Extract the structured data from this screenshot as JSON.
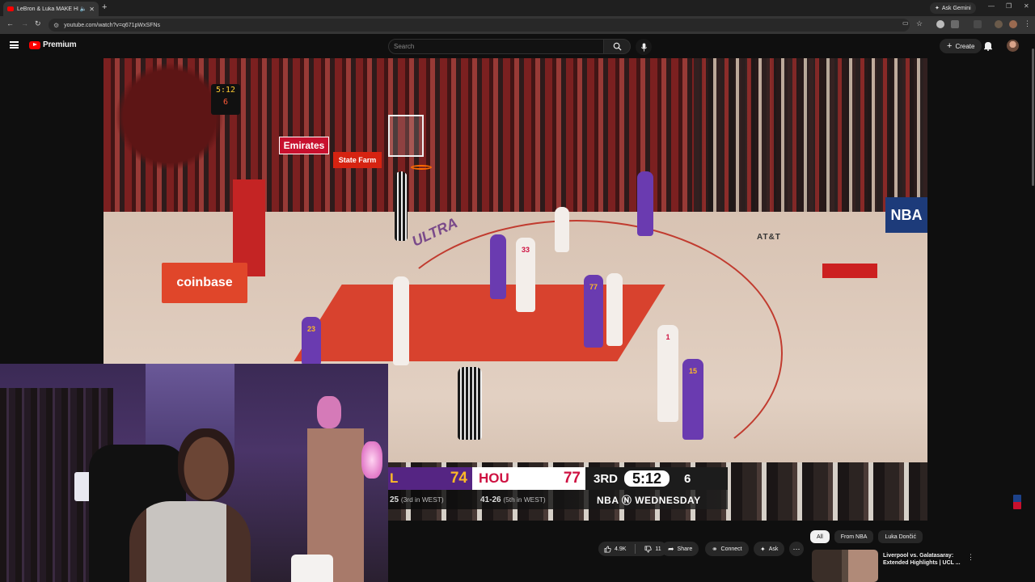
{
  "browser": {
    "tab_title": "LeBron & Luka MAKE HISTORY",
    "url": "youtube.com/watch?v=q671pWxSFNs",
    "ask_gemini": "Ask Gemini"
  },
  "header": {
    "logo_text": "Premium",
    "search_placeholder": "Search",
    "create_label": "Create"
  },
  "video": {
    "ads": {
      "emirates": "Emirates",
      "statefarm": "State Farm",
      "coinbase": "coinbase",
      "nba": "NBA",
      "att": "AT&T",
      "ultra": "ULTRA"
    },
    "shot_clock": {
      "game": "5:12",
      "shot": "6"
    },
    "jersey_numbers": [
      "23",
      "33",
      "77",
      "1",
      "15"
    ],
    "scoreboard": {
      "away_abbr": "L",
      "away_score": "74",
      "home_abbr": "HOU",
      "home_score": "77",
      "quarter": "3RD",
      "time": "5:12",
      "shot_clock": "6",
      "away_record": "25",
      "away_standing": "(3rd in WEST)",
      "home_record": "41-26",
      "home_standing": "(5th in WEST)",
      "broadcast": "NBA Ⓝ WEDNESDAY"
    }
  },
  "actions": {
    "likes": "4.9K",
    "dislikes": "11",
    "share": "Share",
    "connect": "Connect",
    "ask": "Ask"
  },
  "chips": [
    "All",
    "From NBA",
    "Luka Dončić"
  ],
  "recommended": {
    "title": "Liverpool vs. Galatasaray: Extended Highlights | UCL ..."
  },
  "colors": {
    "lakers_purple": "#552583",
    "lakers_gold": "#fdb927",
    "rockets_red": "#ce1141",
    "yt_red": "#ff0000"
  }
}
